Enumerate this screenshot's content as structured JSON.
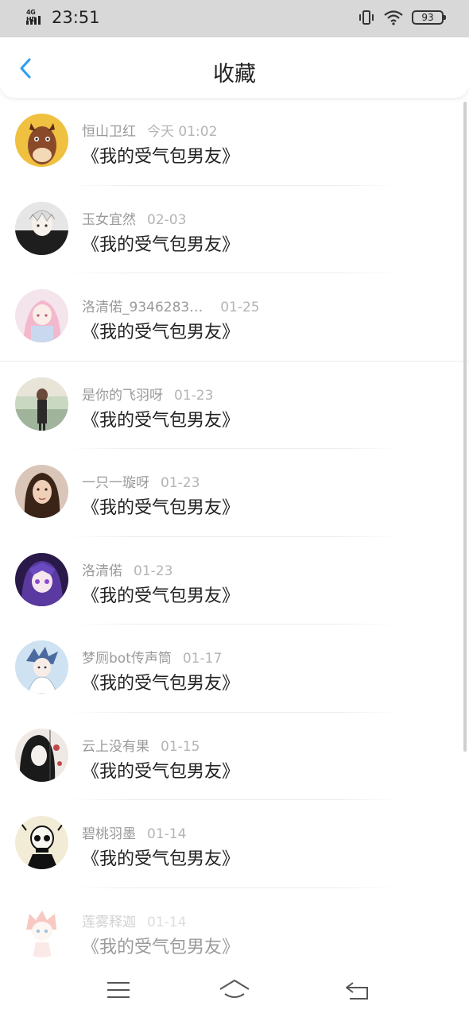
{
  "status_bar": {
    "network": "4G HD",
    "time": "23:51",
    "battery": "93"
  },
  "header": {
    "title": "收藏",
    "back_icon": "back-chevron-icon"
  },
  "favorites": [
    {
      "user": "恒山卫红",
      "date": "今天 01:02",
      "post": "《我的受气包男友》",
      "avatar": "horse-cartoon"
    },
    {
      "user": "玉女宜然",
      "date": "02-03",
      "post": "《我的受气包男友》",
      "avatar": "anime-dark"
    },
    {
      "user": "洛清偌_9346283…",
      "date": "01-25",
      "post": "《我的受气包男友》",
      "avatar": "anime-pink"
    },
    {
      "user": "是你的飞羽呀",
      "date": "01-23",
      "post": "《我的受气包男友》",
      "avatar": "photo-girl"
    },
    {
      "user": "一只一璇呀",
      "date": "01-23",
      "post": "《我的受气包男友》",
      "avatar": "photo-woman"
    },
    {
      "user": "洛清偌",
      "date": "01-23",
      "post": "《我的受气包男友》",
      "avatar": "anime-purple"
    },
    {
      "user": "梦厕bot传声筒",
      "date": "01-17",
      "post": "《我的受气包男友》",
      "avatar": "anime-blue"
    },
    {
      "user": "云上没有果",
      "date": "01-15",
      "post": "《我的受气包男友》",
      "avatar": "manga-bw"
    },
    {
      "user": "碧桃羽墨",
      "date": "01-14",
      "post": "《我的受气包男友》",
      "avatar": "skull-art"
    },
    {
      "user": "莲雾释迦",
      "date": "01-14",
      "post": "《我的受气包男友》",
      "avatar": "chibi-pink"
    }
  ],
  "nav": {
    "menu_icon": "menu-icon",
    "home_icon": "home-icon",
    "back_icon": "return-icon"
  },
  "colors": {
    "accent": "#2a9df4",
    "status_bar_bg": "#d8d8d8",
    "text_primary": "#222222",
    "text_secondary": "#9a9a9a"
  }
}
